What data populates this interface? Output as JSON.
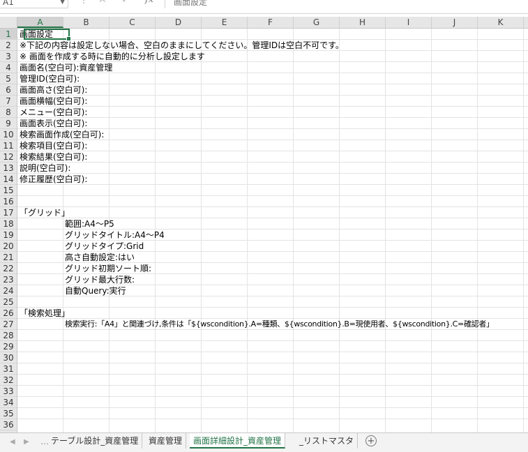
{
  "formula_bar": {
    "cell_ref": "A1",
    "fx_label": "fx",
    "formula": "画面設定"
  },
  "columns": [
    "A",
    "B",
    "C",
    "D",
    "E",
    "F",
    "G",
    "H",
    "I",
    "J",
    "K"
  ],
  "rows": [
    "1",
    "2",
    "3",
    "4",
    "5",
    "6",
    "7",
    "8",
    "9",
    "10",
    "11",
    "12",
    "13",
    "14",
    "15",
    "16",
    "17",
    "18",
    "19",
    "20",
    "21",
    "22",
    "23",
    "24",
    "25",
    "26",
    "27",
    "28",
    "29",
    "30",
    "31",
    "32",
    "33",
    "34",
    "35",
    "36"
  ],
  "cells": {
    "a1": "画面設定",
    "a2": "※下記の内容は設定しない場合、空白のままにしてください。管理IDは空白不可です。",
    "a3": "※ 画面を作成する時に自動的に分析し設定します",
    "a4": "画面名(空白可):資産管理",
    "a5": "管理ID(空白可):",
    "a6": "画面高さ(空白可):",
    "a7": "画面横幅(空白可):",
    "a8": "メニュー(空白可):",
    "a9": "画面表示(空白可):",
    "a10": "検索画面作成(空白可):",
    "a11": "検索項目(空白可):",
    "a12": "検索結果(空白可):",
    "a13": "説明(空白可):",
    "a14": "修正履歴(空白可):",
    "a17": "「グリッド」",
    "b18": "範囲:A4～P5",
    "b19": "グリッドタイトル:A4～P4",
    "b20": "グリッドタイプ:Grid",
    "b21": "高さ自動設定:はい",
    "b22": "グリッド初期ソート順:",
    "b23": "グリッド最大行数:",
    "b24": "自動Query:実行",
    "a26": "「検索処理」",
    "b27": "検索実行:「A4」と関連づけ,条件は「${wscondition}.A=種類、${wscondition}.B=現使用者、${wscondition}.C=確認者」"
  },
  "sheet_tabs": [
    {
      "label": "テーブル設計_資産管理",
      "active": false
    },
    {
      "label": "資産管理",
      "active": false
    },
    {
      "label": "画面詳細設計_資産管理",
      "active": true
    },
    {
      "label": "_リストマスタ",
      "active": false
    }
  ],
  "icons": {
    "cancel": "cancel-icon",
    "enter": "enter-icon",
    "add_sheet": "add-sheet-icon",
    "prev_sheet": "prev-sheet-arrow-icon",
    "next_sheet": "next-sheet-arrow-icon"
  },
  "colors": {
    "accent": "#217346",
    "header_bg": "#e6e6e6",
    "gridline": "#e3e3e3"
  }
}
